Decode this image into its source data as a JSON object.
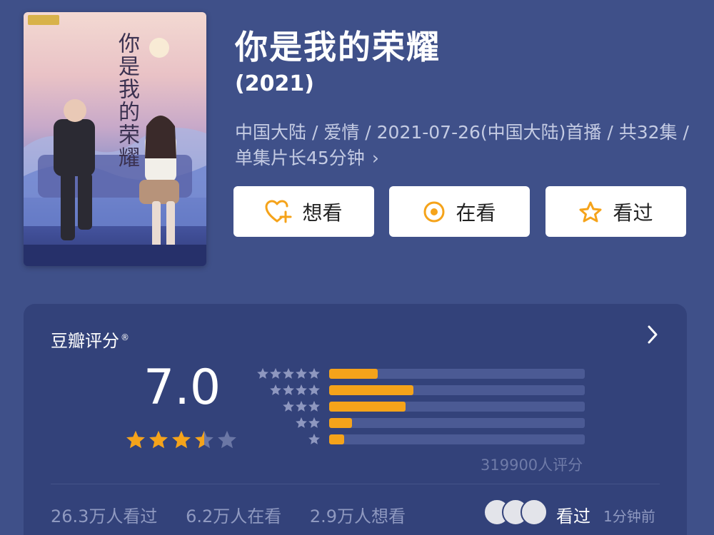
{
  "movie": {
    "title": "你是我的荣耀",
    "year": "(2021)",
    "meta": "中国大陆 / 爱情 / 2021-07-26(中国大陆)首播 / 共32集 / 单集片长45分钟",
    "poster_title": "你是我的荣耀"
  },
  "actions": {
    "want_label": "想看",
    "watching_label": "在看",
    "watched_label": "看过"
  },
  "rating": {
    "section_title": "豆瓣评分",
    "registered_mark": "®",
    "score": "7.0",
    "score_stars_value": 3.5,
    "distribution": [
      {
        "stars": 5,
        "fraction": 0.19
      },
      {
        "stars": 4,
        "fraction": 0.33
      },
      {
        "stars": 3,
        "fraction": 0.3
      },
      {
        "stars": 2,
        "fraction": 0.09
      },
      {
        "stars": 1,
        "fraction": 0.06
      }
    ],
    "rating_count": "319900人评分"
  },
  "stats": {
    "watched": "26.3万人看过",
    "watching": "6.2万人在看",
    "want": "2.9万人想看"
  },
  "activity": {
    "label": "看过",
    "time": "1分钟前"
  },
  "colors": {
    "background": "#3f5089",
    "card": "#33427a",
    "accent": "#f5a31a",
    "bar_track": "#4b5a94"
  },
  "icons": {
    "want": "heart-plus-icon",
    "watching": "target-icon",
    "watched": "star-icon",
    "chevron": "chevron-right-icon"
  }
}
